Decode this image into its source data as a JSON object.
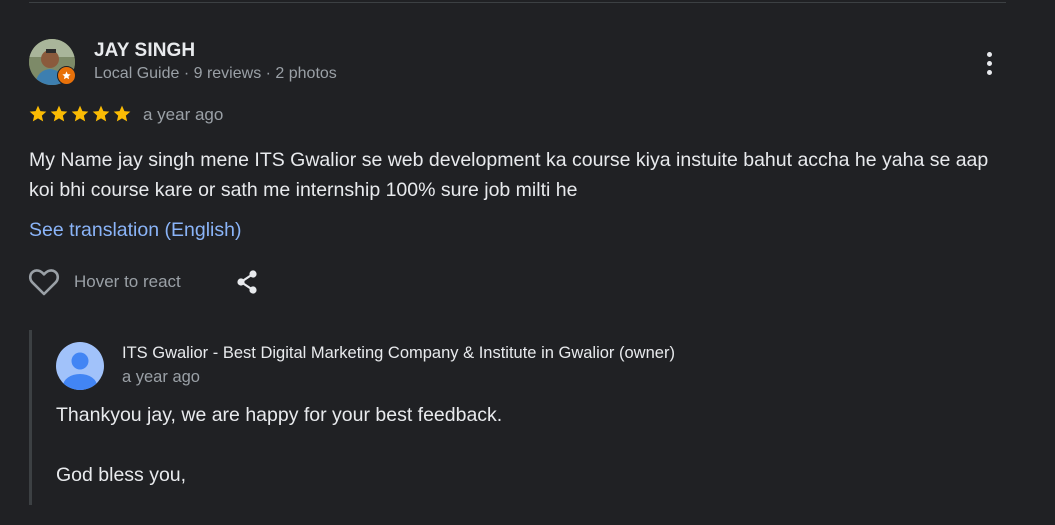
{
  "review": {
    "reviewer_name": "JAY SINGH",
    "reviewer_meta": "Local Guide · 9 reviews · 2 photos",
    "rating": 5,
    "time": "a year ago",
    "text": "My Name jay singh mene ITS Gwalior se web development ka course kiya instuite bahut accha he yaha se aap koi bhi course kare or sath me internship 100% sure job milti he",
    "see_translation": "See translation (English)",
    "react_label": "Hover to react"
  },
  "owner_reply": {
    "name": "ITS Gwalior - Best Digital Marketing Company & Institute in Gwalior (owner)",
    "time": "a year ago",
    "line1": "Thankyou jay, we are happy for your best feedback.",
    "line2": "God bless you,"
  },
  "colors": {
    "background": "#202124",
    "star": "#fbbc04",
    "link": "#8ab4f8",
    "guide_badge": "#e8710a"
  },
  "icons": [
    "star-icon",
    "more-vert-icon",
    "heart-icon",
    "share-icon",
    "local-guide-badge-icon",
    "default-avatar-icon"
  ]
}
